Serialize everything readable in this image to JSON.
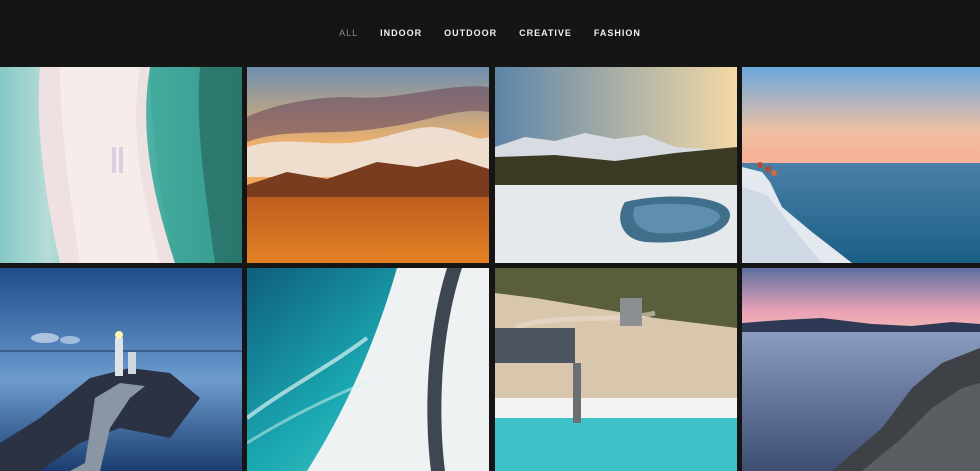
{
  "filters": [
    {
      "label": "ALL",
      "active": true
    },
    {
      "label": "INDOOR",
      "active": false
    },
    {
      "label": "OUTDOOR",
      "active": false
    },
    {
      "label": "CREATIVE",
      "active": false
    },
    {
      "label": "FASHION",
      "active": false
    }
  ],
  "gallery": [
    {
      "subject": "aerial sandbar and turquoise sea"
    },
    {
      "subject": "orange sunset over mountains and clouds"
    },
    {
      "subject": "snowy mountain lake with pine forest"
    },
    {
      "subject": "people on white cliff by the sea at dusk"
    },
    {
      "subject": "lighthouse on rocky coast at blue hour"
    },
    {
      "subject": "aerial beach road along turquoise water"
    },
    {
      "subject": "aerial coastline with pier and waves"
    },
    {
      "subject": "rocky shore at pink sunset"
    }
  ]
}
